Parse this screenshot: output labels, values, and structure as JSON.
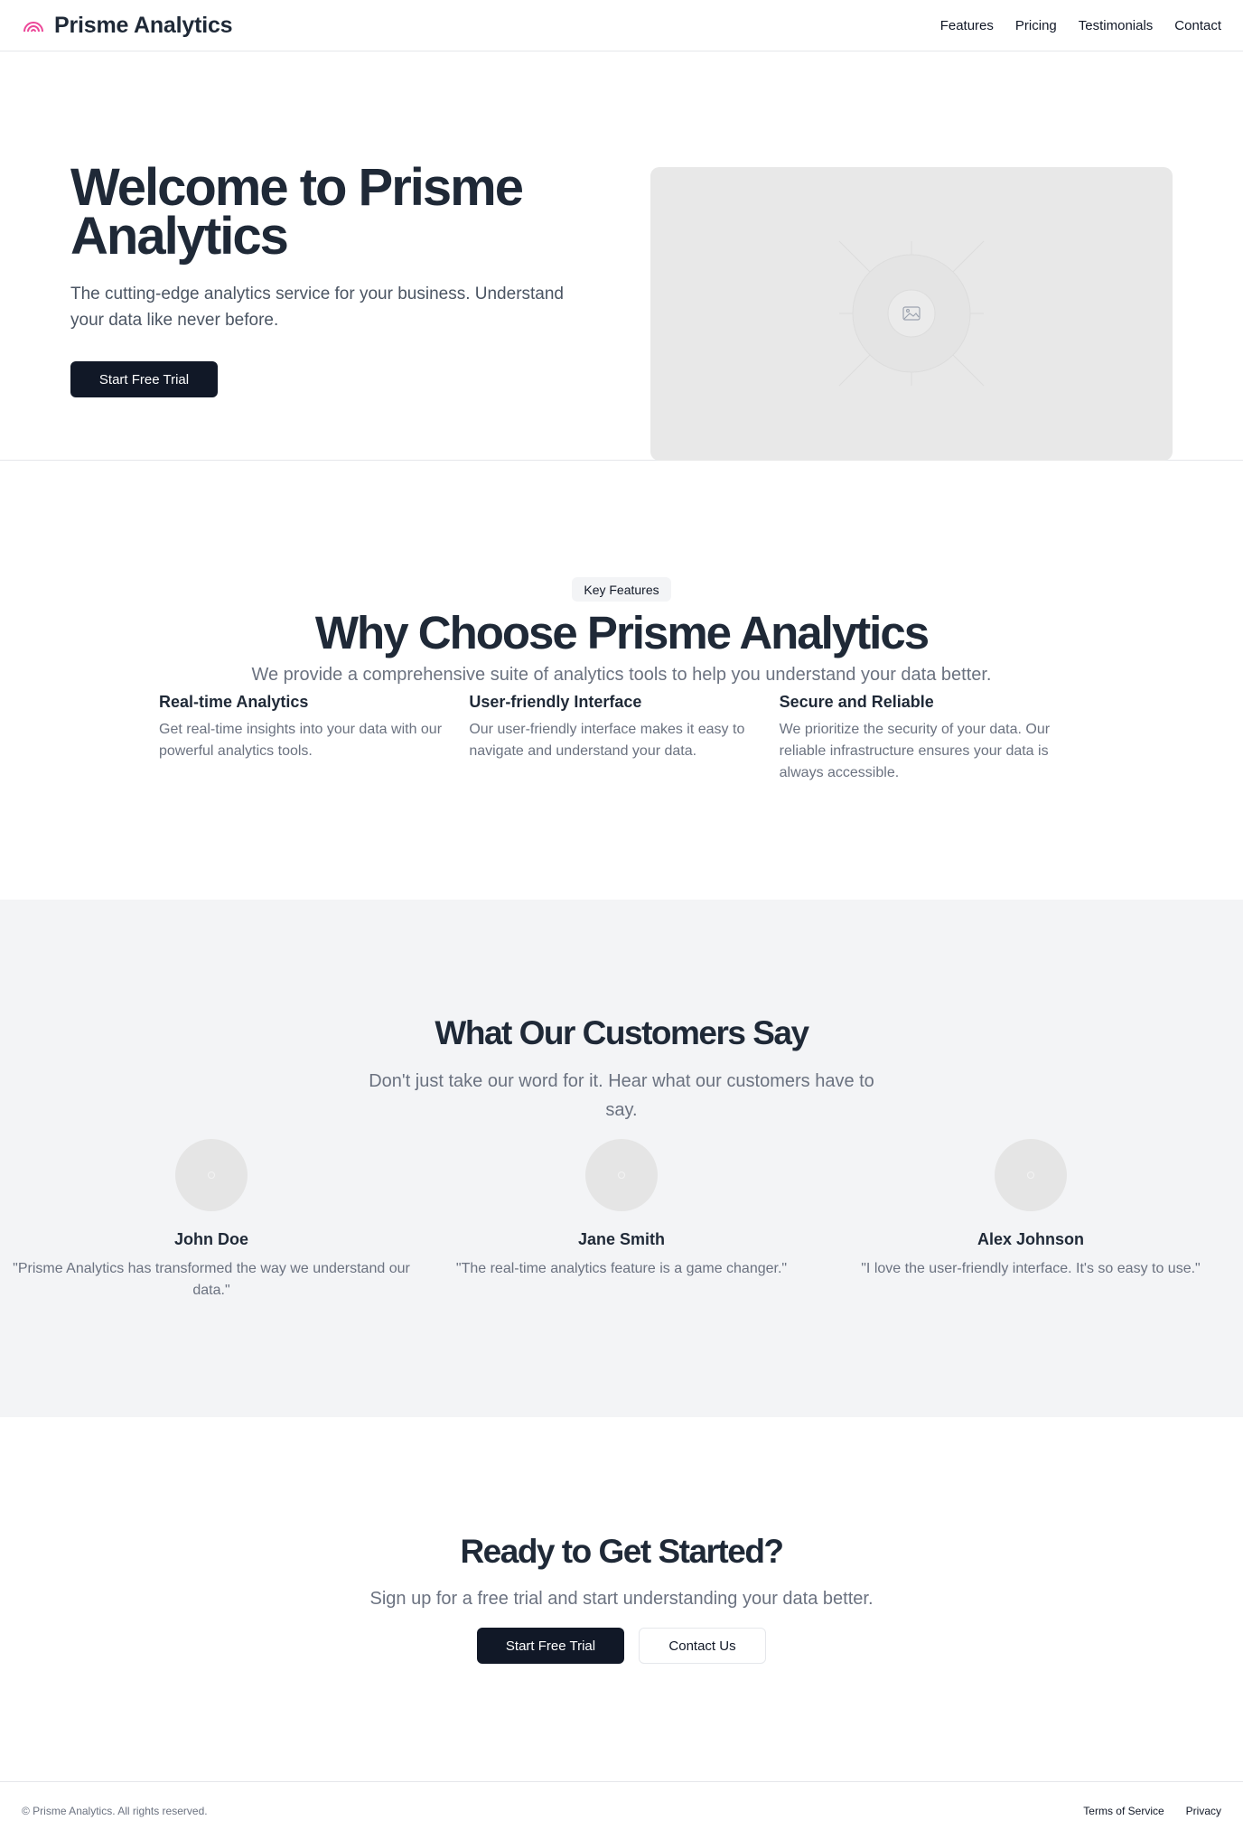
{
  "header": {
    "brand": "Prisme Analytics",
    "logo_icon": "rainbow-arc-icon",
    "logo_color": "#ec4899",
    "nav": [
      "Features",
      "Pricing",
      "Testimonials",
      "Contact"
    ]
  },
  "hero": {
    "title": "Welcome to Prisme Analytics",
    "subtitle": "The cutting-edge analytics service for your business. Understand your data like never before.",
    "cta_label": "Start Free Trial",
    "image_icon": "image-placeholder-icon"
  },
  "features": {
    "badge": "Key Features",
    "title": "Why Choose Prisme Analytics",
    "subtitle": "We provide a comprehensive suite of analytics tools to help you understand your data better.",
    "items": [
      {
        "title": "Real-time Analytics",
        "text": "Get real-time insights into your data with our powerful analytics tools."
      },
      {
        "title": "User-friendly Interface",
        "text": "Our user-friendly interface makes it easy to navigate and understand your data."
      },
      {
        "title": "Secure and Reliable",
        "text": "We prioritize the security of your data. Our reliable infrastructure ensures your data is always accessible."
      }
    ]
  },
  "testimonials": {
    "title": "What Our Customers Say",
    "subtitle": "Don't just take our word for it. Hear what our customers have to say.",
    "items": [
      {
        "name": "John Doe",
        "quote": "\"Prisme Analytics has transformed the way we understand our data.\""
      },
      {
        "name": "Jane Smith",
        "quote": "\"The real-time analytics feature is a game changer.\""
      },
      {
        "name": "Alex Johnson",
        "quote": "\"I love the user-friendly interface. It's so easy to use.\""
      }
    ]
  },
  "cta": {
    "title": "Ready to Get Started?",
    "subtitle": "Sign up for a free trial and start understanding your data better.",
    "primary_label": "Start Free Trial",
    "secondary_label": "Contact Us"
  },
  "footer": {
    "copyright": "© Prisme Analytics. All rights reserved.",
    "links": [
      "Terms of Service",
      "Privacy"
    ]
  }
}
